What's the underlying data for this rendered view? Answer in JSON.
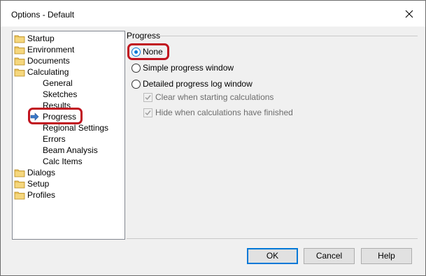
{
  "window": {
    "title": "Options - Default"
  },
  "tree": {
    "items": [
      {
        "label": "Startup",
        "icon": "folder-icon"
      },
      {
        "label": "Environment",
        "icon": "folder-icon"
      },
      {
        "label": "Documents",
        "icon": "folder-icon"
      },
      {
        "label": "Calculating",
        "icon": "folder-icon"
      },
      {
        "label": "General"
      },
      {
        "label": "Sketches"
      },
      {
        "label": "Results"
      },
      {
        "label": "Progress",
        "icon": "arrow-right-icon",
        "selected": true
      },
      {
        "label": "Regional Settings"
      },
      {
        "label": "Errors"
      },
      {
        "label": "Beam Analysis"
      },
      {
        "label": "Calc Items"
      },
      {
        "label": "Dialogs",
        "icon": "folder-icon"
      },
      {
        "label": "Setup",
        "icon": "folder-icon"
      },
      {
        "label": "Profiles",
        "icon": "folder-icon"
      }
    ]
  },
  "progress": {
    "group_title": "Progress",
    "options": [
      {
        "label": "None",
        "checked": true
      },
      {
        "label": "Simple progress window",
        "checked": false
      },
      {
        "label": "Detailed progress log window",
        "checked": false
      }
    ],
    "checkboxes": [
      {
        "label": "Clear when starting calculations",
        "checked": true,
        "enabled": false
      },
      {
        "label": "Hide when calculations have finished",
        "checked": true,
        "enabled": false
      }
    ]
  },
  "buttons": {
    "ok": "OK",
    "cancel": "Cancel",
    "help": "Help"
  },
  "colors": {
    "highlight": "#c1131f",
    "accent": "#0078d7",
    "folder": "#e8c15a"
  }
}
